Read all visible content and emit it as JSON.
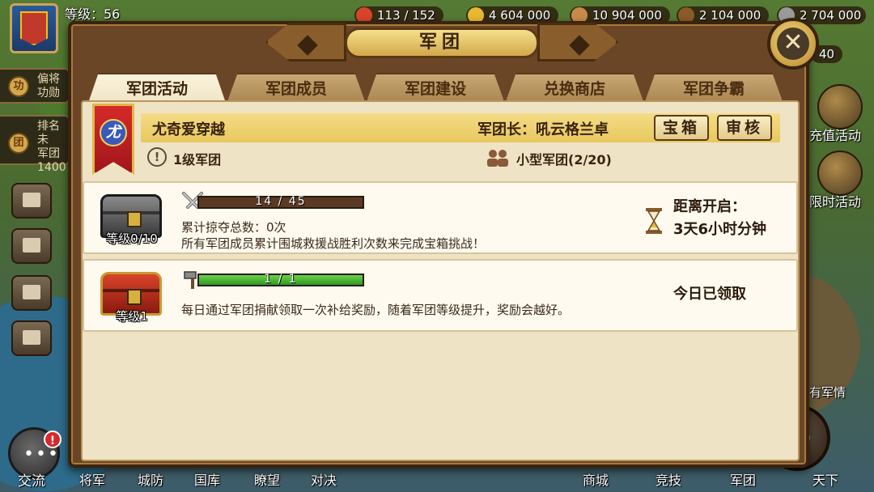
{
  "hud": {
    "level_label": "等级：56",
    "resources": [
      {
        "name": "stamina",
        "value": "113 / 152",
        "color": "#d8442a"
      },
      {
        "name": "gold",
        "value": "4 604 000",
        "color": "#e8b830"
      },
      {
        "name": "food",
        "value": "10 904 000",
        "color": "#c88a4a"
      },
      {
        "name": "wood",
        "value": "2 104 000",
        "color": "#8a5a2a"
      },
      {
        "name": "stone",
        "value": "2 704 000",
        "color": "#9a9a9a"
      }
    ],
    "extra_counter": "40",
    "left_panel": [
      {
        "line1": "偏将",
        "line2": "功勋"
      },
      {
        "line1": "排名未",
        "line2": "军团",
        "line3": "1400"
      }
    ],
    "right_menu": [
      "充值活动",
      "限时活动"
    ],
    "bottom_nav": [
      "将军",
      "城防",
      "国库",
      "瞭望",
      "对决",
      "商城",
      "竞技",
      "军团",
      "天下"
    ],
    "chat_label": "交流",
    "chat_badge": "!",
    "news_label": "有军情"
  },
  "dialog": {
    "title": "军团",
    "close_symbol": "✕",
    "tabs": [
      "军团活动",
      "军团成员",
      "军团建设",
      "兑换商店",
      "军团争霸"
    ],
    "active_tab": 0,
    "guild": {
      "emblem_char": "尤",
      "name": "尤奇爱穿越",
      "leader": "军团长：吼云格兰卓",
      "btn_chest": "宝箱",
      "btn_review": "审核",
      "level": "1级军团",
      "size": "小型军团(2/20)"
    },
    "activities": [
      {
        "chest_label": "等级0/10",
        "progress_text": "14 / 45",
        "progress": 0.0,
        "line1": "累计掠夺总数：0次",
        "line2": "所有军团成员累计围城救援战胜利次数来完成宝箱挑战！",
        "status_line1": "距离开启：",
        "status_line2": "3天6小时分钟"
      },
      {
        "chest_label": "等级1",
        "progress_text": "1 / 1",
        "progress": 1.0,
        "line1": "每日通过军团捐献领取一次补给奖励，随着军团等级提升，奖励会越好。",
        "status_line1": "今日已领取"
      }
    ]
  }
}
